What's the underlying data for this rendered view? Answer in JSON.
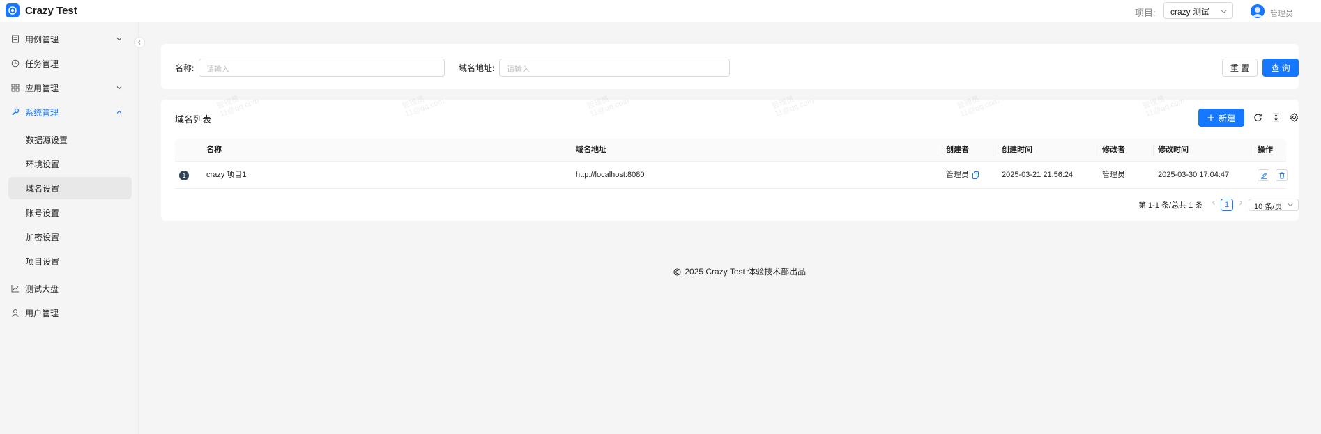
{
  "header": {
    "app_title": "Crazy Test",
    "project_label": "项目:",
    "project_value": "crazy 测试",
    "user_name": "管理员"
  },
  "sidebar": {
    "items": [
      {
        "label": "用例管理",
        "icon": "file-text-icon",
        "expandable": true
      },
      {
        "label": "任务管理",
        "icon": "clock-icon",
        "expandable": false
      },
      {
        "label": "应用管理",
        "icon": "appstore-icon",
        "expandable": true
      },
      {
        "label": "系统管理",
        "icon": "tool-icon",
        "expandable": true,
        "expanded": true
      }
    ],
    "sub_items": [
      "数据源设置",
      "环境设置",
      "域名设置",
      "账号设置",
      "加密设置",
      "项目设置"
    ],
    "selected_sub_item": "域名设置",
    "bottom_items": [
      {
        "label": "测试大盘",
        "icon": "line-chart-icon"
      },
      {
        "label": "用户管理",
        "icon": "user-icon"
      }
    ]
  },
  "search": {
    "name_label": "名称:",
    "name_placeholder": "请输入",
    "domain_label": "域名地址:",
    "domain_placeholder": "请输入",
    "reset_label": "重 置",
    "query_label": "查 询"
  },
  "table": {
    "title": "域名列表",
    "new_label": "新建",
    "columns": [
      "名称",
      "域名地址",
      "创建者",
      "创建时间",
      "修改者",
      "修改时间",
      "操作"
    ],
    "rows": [
      {
        "index": "1",
        "name": "crazy 项目1",
        "domain": "http://localhost:8080",
        "creator": "管理员",
        "created_at": "2025-03-21 21:56:24",
        "modifier": "管理员",
        "modified_at": "2025-03-30 17:04:47"
      }
    ]
  },
  "pagination": {
    "summary": "第 1-1 条/总共 1 条",
    "current_page": "1",
    "page_size": "10 条/页"
  },
  "footer": {
    "text": "2025 Crazy Test 体验技术部出品"
  },
  "watermark": {
    "line1": "管理员",
    "line2": "11@qq.com"
  },
  "colors": {
    "primary": "#1677ff",
    "badge": "#314659"
  }
}
